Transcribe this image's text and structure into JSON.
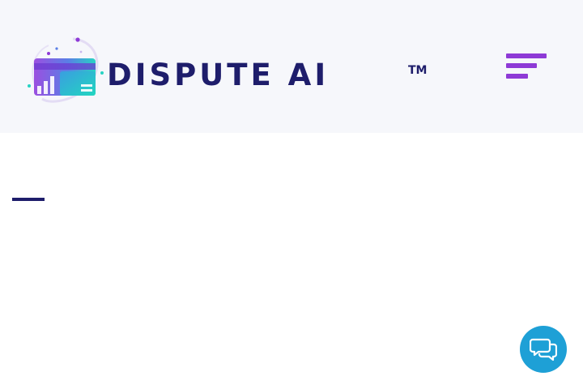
{
  "header": {
    "logo": {
      "text": "DISPUTE AI",
      "trademark": "TM"
    },
    "menu_icon": "hamburger-menu-icon"
  },
  "chat": {
    "icon": "chat-bubbles-icon"
  },
  "colors": {
    "header_bg": "#f6f7fb",
    "brand_navy": "#1e1d6b",
    "menu_purple": "#8e3ad6",
    "chat_blue": "#1ea0d6"
  }
}
